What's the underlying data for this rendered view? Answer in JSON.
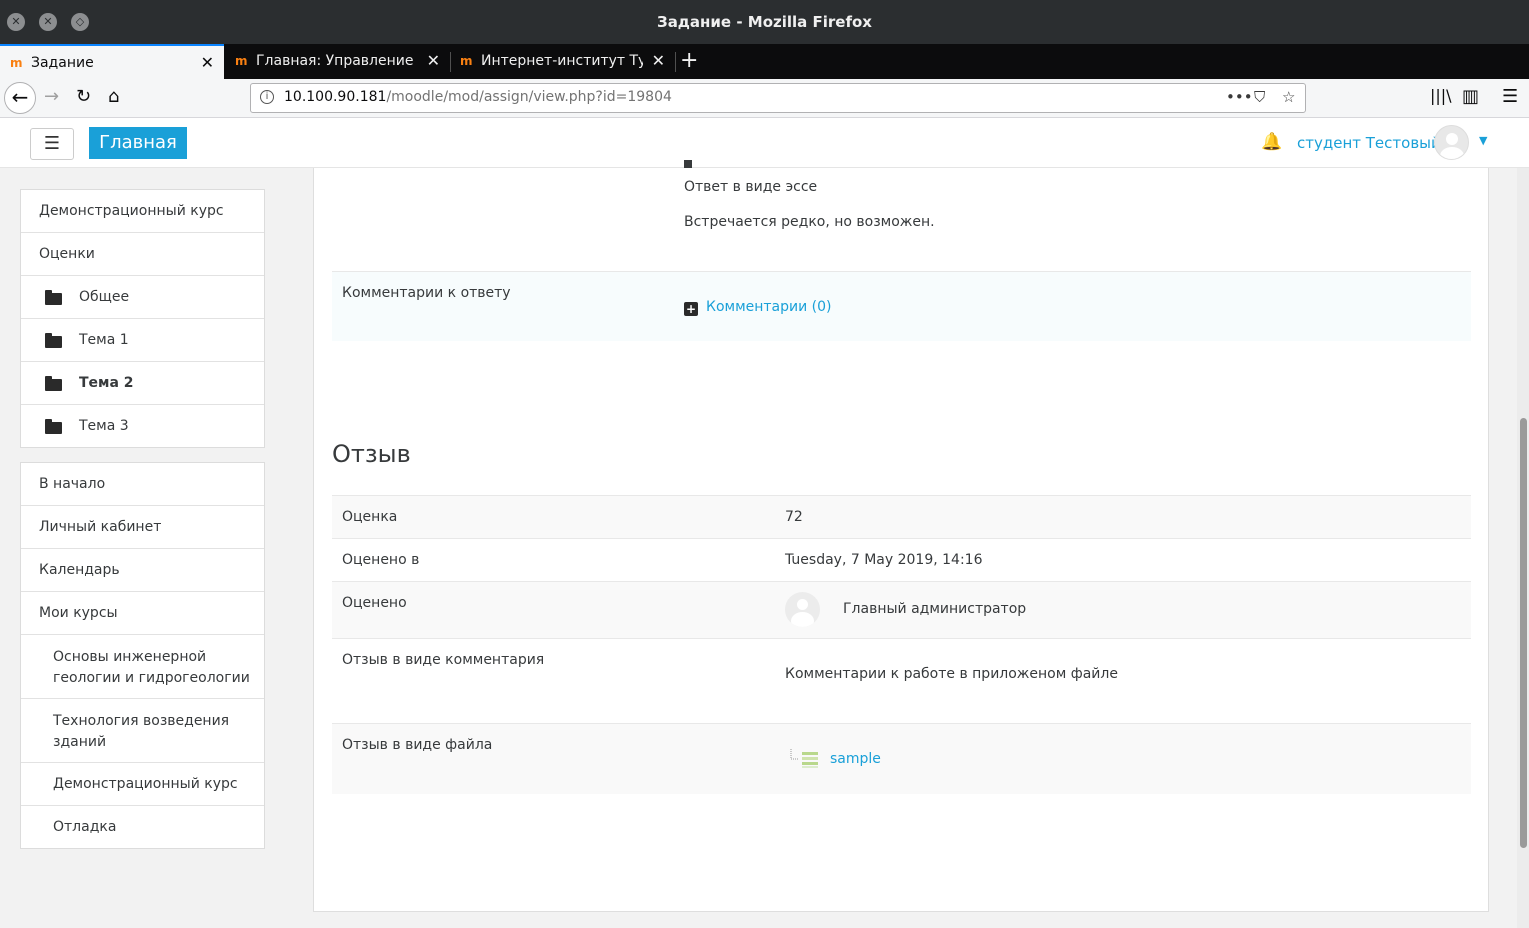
{
  "window": {
    "title": "Задание - Mozilla Firefox"
  },
  "tabs": [
    {
      "label": "Задание",
      "active": true
    },
    {
      "label": "Главная: Управление",
      "active": false
    },
    {
      "label": "Интернет-институт Ту",
      "active": false
    }
  ],
  "url": {
    "host": "10.100.90.181",
    "path": "/moodle/mod/assign/view.php?id=19804"
  },
  "header": {
    "brand": "Главная",
    "user_name": "студент Тестовый"
  },
  "sidebar": {
    "course_nav": [
      {
        "label": "Демонстрационный курс",
        "folder": false,
        "bold": false
      },
      {
        "label": "Оценки",
        "folder": false,
        "bold": false
      },
      {
        "label": "Общее",
        "folder": true,
        "bold": false
      },
      {
        "label": "Тема 1",
        "folder": true,
        "bold": false
      },
      {
        "label": "Тема 2",
        "folder": true,
        "bold": true
      },
      {
        "label": "Тема 3",
        "folder": true,
        "bold": false
      }
    ],
    "site_nav": [
      {
        "label": "В начало",
        "indent": false
      },
      {
        "label": "Личный кабинет",
        "indent": false
      },
      {
        "label": "Календарь",
        "indent": false
      },
      {
        "label": "Мои курсы",
        "indent": false
      },
      {
        "label": "Основы инженерной геологии и гидрогеологии",
        "indent": true
      },
      {
        "label": "Технология возведения зданий",
        "indent": true
      },
      {
        "label": "Демонстрационный курс",
        "indent": true
      },
      {
        "label": "Отладка",
        "indent": true
      }
    ]
  },
  "submission": {
    "text_line1": "Ответ в виде эссе",
    "text_line2": "Встречается редко, но возможен.",
    "comments_label": "Комментарии к ответу",
    "comments_link": "Комментарии (0)"
  },
  "feedback": {
    "heading": "Отзыв",
    "grade_label": "Оценка",
    "grade_value": "72",
    "graded_on_label": "Оценено в",
    "graded_on_value": "Tuesday, 7 May 2019, 14:16",
    "graded_by_label": "Оценено",
    "graded_by_value": "Главный администратор",
    "comment_label": "Отзыв в виде комментария",
    "comment_value": "Комментарии к работе в приложеном файле",
    "file_label": "Отзыв в виде файла",
    "file_name": "sample"
  }
}
